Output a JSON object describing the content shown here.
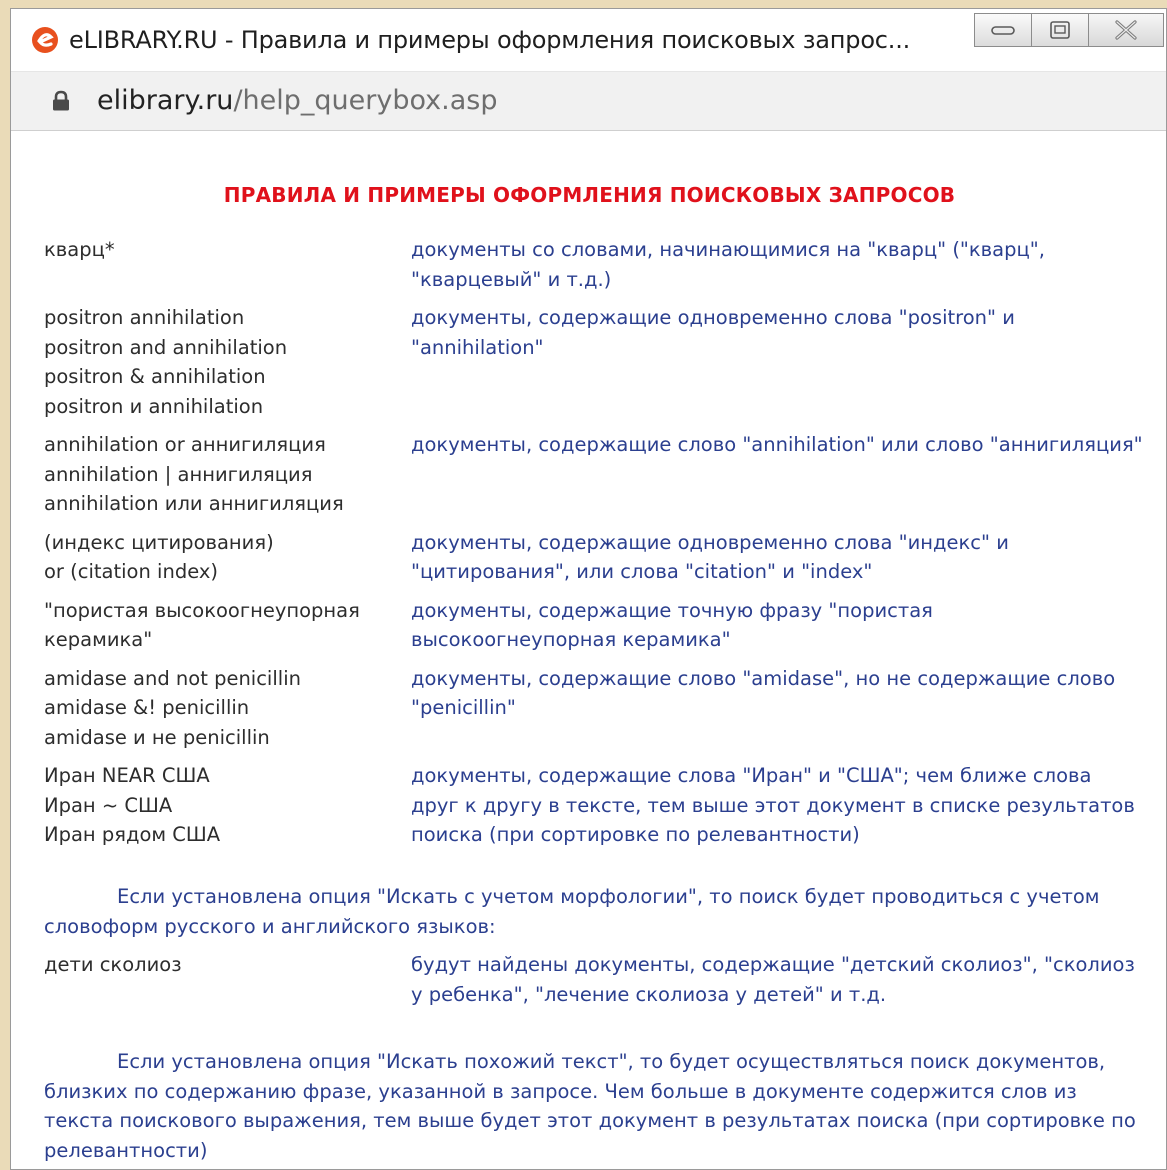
{
  "window": {
    "title": "eLIBRARY.RU - Правила и примеры оформления поисковых запрос...",
    "url_host": "elibrary.ru",
    "url_path": "/help_querybox.asp"
  },
  "page": {
    "heading": "ПРАВИЛА И ПРИМЕРЫ ОФОРМЛЕНИЯ ПОИСКОВЫХ ЗАПРОСОВ",
    "rules": [
      {
        "queries": [
          "кварц*"
        ],
        "desc": "документы со словами, начинающимися на \"кварц\" (\"кварц\", \"кварцевый\" и т.д.)"
      },
      {
        "queries": [
          "positron annihilation",
          "positron and annihilation",
          "positron & annihilation",
          "positron и annihilation"
        ],
        "desc": "документы, содержащие одновременно слова \"positron\" и \"annihilation\""
      },
      {
        "queries": [
          "annihilation or аннигиляция",
          "annihilation | аннигиляция",
          "annihilation или аннигиляция"
        ],
        "desc": "документы, содержащие слово \"annihilation\" или слово \"аннигиляция\""
      },
      {
        "queries": [
          "(индекс цитирования)",
          "or (citation index)"
        ],
        "desc": "документы, содержащие одновременно слова \"индекс\" и \"цитирования\", или слова \"citation\" и \"index\""
      },
      {
        "queries": [
          "\"пористая высокоогнеупорная",
          "керамика\""
        ],
        "desc": "документы, содержащие точную фразу \"пористая высокоогнеупорная керамика\""
      },
      {
        "queries": [
          "amidase and not penicillin",
          "amidase &! penicillin",
          "amidase и не penicillin"
        ],
        "desc": "документы, содержащие слово \"amidase\", но не содержащие слово \"penicillin\""
      },
      {
        "queries": [
          "Иран NEAR США",
          "Иран ~ США",
          "Иран рядом США"
        ],
        "desc": "документы, содержащие слова \"Иран\" и \"США\"; чем ближе слова друг к другу в тексте, тем выше этот документ в списке результатов поиска (при сортировке по релевантности)"
      }
    ],
    "morphology_note": "Если установлена опция \"Искать с учетом морфологии\", то поиск будет проводиться с учетом словоформ русского и английского языков:",
    "morphology_example": {
      "query": "дети сколиоз",
      "desc": "будут найдены документы, содержащие \"детский сколиоз\", \"сколиоз у ребенка\", \"лечение сколиоза у детей\" и т.д."
    },
    "similar_note": "Если установлена опция \"Искать похожий текст\", то будет осуществляться поиск документов, близких по содержанию фразе, указанной в запросе. Чем больше в документе содержится слов из текста поискового выражения, тем выше будет этот документ в результатах поиска (при сортировке по релевантности)"
  }
}
